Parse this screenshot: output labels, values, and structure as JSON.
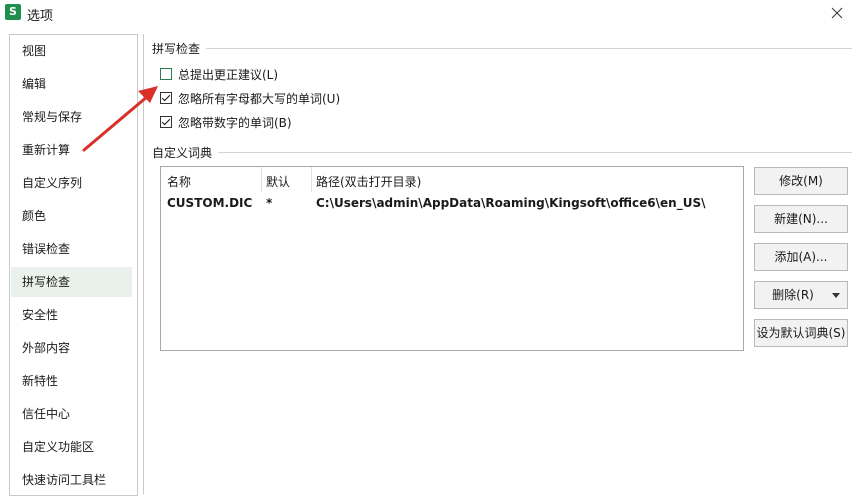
{
  "window": {
    "title": "选项",
    "app_icon_letter": "S",
    "app_icon_color": "#1f8f4e"
  },
  "sidebar": {
    "items": [
      {
        "label": "视图"
      },
      {
        "label": "编辑"
      },
      {
        "label": "常规与保存"
      },
      {
        "label": "重新计算"
      },
      {
        "label": "自定义序列"
      },
      {
        "label": "颜色"
      },
      {
        "label": "错误检查"
      },
      {
        "label": "拼写检查",
        "selected": true
      },
      {
        "label": "安全性"
      },
      {
        "label": "外部内容"
      },
      {
        "label": "新特性"
      },
      {
        "label": "信任中心"
      },
      {
        "label": "自定义功能区"
      },
      {
        "label": "快速访问工具栏"
      }
    ]
  },
  "spell_check": {
    "group_title": "拼写检查",
    "options": [
      {
        "label": "总提出更正建议(L)",
        "checked": false
      },
      {
        "label": "忽略所有字母都大写的单词(U)",
        "checked": true
      },
      {
        "label": "忽略带数字的单词(B)",
        "checked": true
      }
    ]
  },
  "custom_dict": {
    "group_title": "自定义词典",
    "columns": [
      "名称",
      "默认",
      "路径(双击打开目录)"
    ],
    "rows": [
      [
        "CUSTOM.DIC",
        "*",
        "C:\\Users\\admin\\AppData\\Roaming\\Kingsoft\\office6\\en_US\\"
      ]
    ],
    "buttons": {
      "modify": "修改(M)",
      "new": "新建(N)...",
      "add": "添加(A)...",
      "delete": "删除(R)",
      "set_default": "设为默认词典(S)"
    }
  },
  "colors": {
    "selected_nav_bg": "#eaf1ec",
    "annotation_arrow": "#d9302a"
  }
}
